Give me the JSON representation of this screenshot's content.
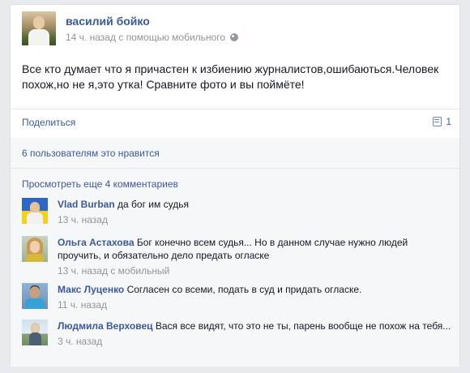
{
  "post": {
    "author": "василий бойко",
    "meta": "14 ч. назад с помощью мобильного",
    "text": "Все кто думает что я причастен к избиению журналистов,ошибаються.Человек похож,но не я,это утка! Сравните фото и вы поймёте!",
    "privacy_icon": "globe-icon"
  },
  "actions": {
    "share_label": "Поделиться",
    "comment_count": "1",
    "comment_icon": "comment-icon"
  },
  "feedback": {
    "likes_text": "6 пользователям это нравится",
    "more_comments_text": "Просмотреть еще 4 комментариев"
  },
  "comments": [
    {
      "author": "Vlad Burban",
      "text": "да бог им судья",
      "time": "13 ч. назад"
    },
    {
      "author": "Ольга Астахова",
      "text": "Бог конечно всем судья... Но в данном случае нужно людей проучить, и обязательно дело предать огласке",
      "time": "13 ч. назад с мобильный"
    },
    {
      "author": "Макс Луценко",
      "text": "Согласен со всеми, подать в суд и придать огласке.",
      "time": "11 ч. назад"
    },
    {
      "author": "Людмила Верховец",
      "text": "Вася все видят, что это не ты, парень вообще не похож на тебя...",
      "time": "3 ч. назад"
    }
  ],
  "colors": {
    "link_blue": "#3b5998",
    "meta_gray": "#90949c",
    "feedback_bg": "#f6f7f9"
  }
}
